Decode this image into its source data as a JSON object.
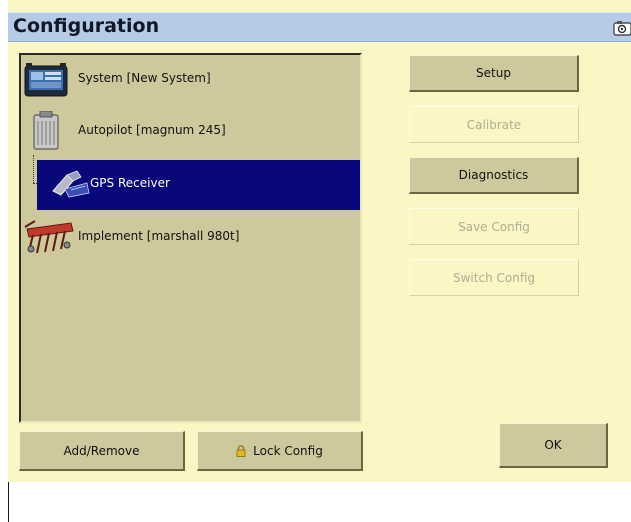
{
  "window": {
    "title": "Configuration"
  },
  "tree": {
    "items": [
      {
        "label": "System [New System]",
        "icon": "display-unit-icon",
        "selected": false
      },
      {
        "label": "Autopilot [magnum 245]",
        "icon": "controller-module-icon",
        "selected": false
      },
      {
        "label": "GPS Receiver",
        "icon": "gps-receiver-icon",
        "selected": true
      },
      {
        "label": "Implement [marshall 980t]",
        "icon": "cultivator-implement-icon",
        "selected": false
      }
    ]
  },
  "buttons": {
    "setup": "Setup",
    "calibrate": "Calibrate",
    "diagnostics": "Diagnostics",
    "save_config": "Save Config",
    "switch_config": "Switch Config",
    "add_remove": "Add/Remove",
    "lock_config": "Lock Config",
    "ok": "OK"
  },
  "colors": {
    "background": "#fbf7c4",
    "panel": "#cdc99c",
    "title_bar": "#b5cbe6",
    "selection": "#08087a",
    "disabled_text": "#b0ad94"
  }
}
